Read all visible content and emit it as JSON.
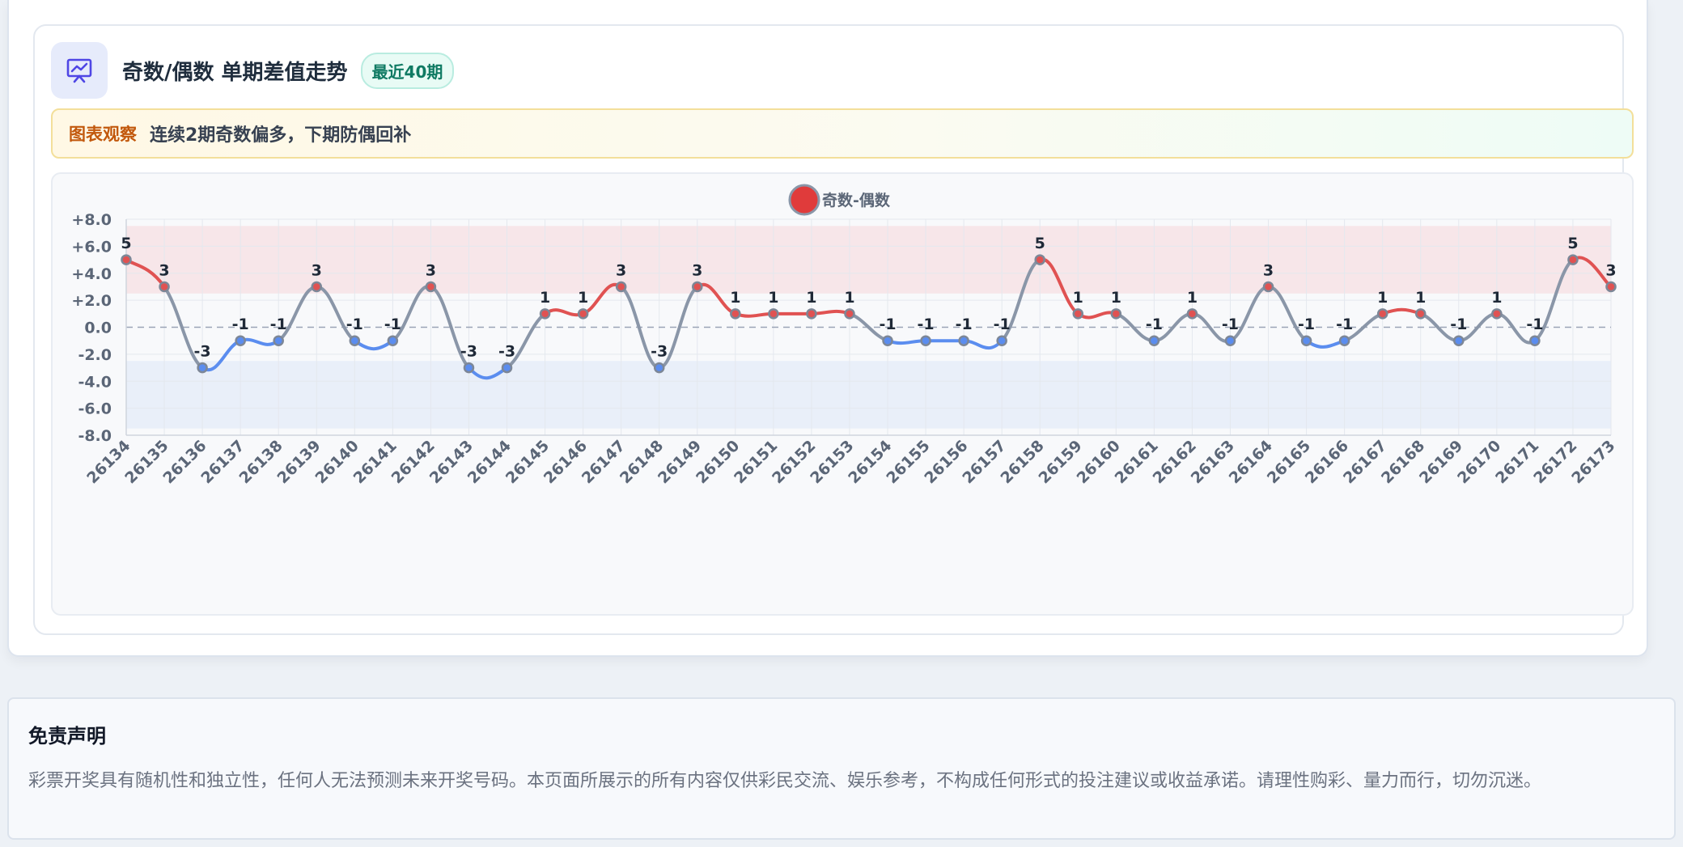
{
  "header": {
    "title": "奇数/偶数 单期差值走势",
    "badge": "最近40期"
  },
  "observation": {
    "label": "图表观察",
    "text": "连续2期奇数偏多，下期防偶回补"
  },
  "colors": {
    "positive": "#e05252",
    "negative": "#5b8def",
    "neutral": "#8a96a8",
    "accent": "#4f46e5"
  },
  "chart_data": {
    "type": "line",
    "x": [
      "26134",
      "26135",
      "26136",
      "26137",
      "26138",
      "26139",
      "26140",
      "26141",
      "26142",
      "26143",
      "26144",
      "26145",
      "26146",
      "26147",
      "26148",
      "26149",
      "26150",
      "26151",
      "26152",
      "26153",
      "26154",
      "26155",
      "26156",
      "26157",
      "26158",
      "26159",
      "26160",
      "26161",
      "26162",
      "26163",
      "26164",
      "26165",
      "26166",
      "26167",
      "26168",
      "26169",
      "26170",
      "26171",
      "26172",
      "26173"
    ],
    "series": [
      {
        "name": "奇数-偶数",
        "values": [
          5,
          3,
          -3,
          -1,
          -1,
          3,
          -1,
          -1,
          3,
          -3,
          -3,
          1,
          1,
          3,
          -3,
          3,
          1,
          1,
          1,
          1,
          -1,
          -1,
          -1,
          -1,
          5,
          1,
          1,
          -1,
          1,
          -1,
          3,
          -1,
          -1,
          1,
          1,
          -1,
          1,
          -1,
          5,
          3
        ]
      }
    ],
    "yticks": [
      "+8.0",
      "+6.0",
      "+4.0",
      "+2.0",
      "0.0",
      "-2.0",
      "-4.0",
      "-6.0",
      "-8.0"
    ],
    "ylim": [
      -8,
      8
    ],
    "bands": {
      "positive": [
        2.5,
        7.5
      ],
      "negative": [
        -7.5,
        -2.5
      ]
    },
    "grid": true,
    "legend": "top-center"
  },
  "disclaimer": {
    "title": "免责声明",
    "text": "彩票开奖具有随机性和独立性，任何人无法预测未来开奖号码。本页面所展示的所有内容仅供彩民交流、娱乐参考，不构成任何形式的投注建议或收益承诺。请理性购彩、量力而行，切勿沉迷。"
  }
}
